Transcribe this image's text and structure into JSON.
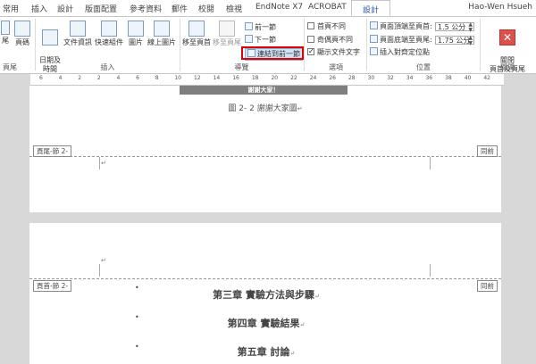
{
  "tabs": [
    {
      "label": "常用"
    },
    {
      "label": "插入"
    },
    {
      "label": "設計"
    },
    {
      "label": "版面配置"
    },
    {
      "label": "參考資料"
    },
    {
      "label": "郵件"
    },
    {
      "label": "校閱"
    },
    {
      "label": "檢視"
    },
    {
      "label": "EndNote X7"
    },
    {
      "label": "ACROBAT"
    },
    {
      "label": "設計"
    }
  ],
  "user_name": "Hao-Wen Hsueh",
  "ribbon": {
    "btn_partial1": "尾",
    "btn_page": "頁碼",
    "group_partial": "頁尾",
    "btn_datetime": "日期及\n時間",
    "btn_docinfo": "文件資訊",
    "btn_quickparts": "快速組件",
    "btn_picture": "圖片",
    "btn_online_picture": "線上圖片",
    "group_insert": "插入",
    "btn_goto_header": "移至頁首",
    "btn_goto_footer": "移至頁尾",
    "btn_previous": "前一節",
    "btn_next": "下一節",
    "btn_link_previous": "連結到前一節",
    "group_nav": "導覽",
    "opt_diff_first": "首頁不同",
    "opt_diff_oddeven": "奇偶頁不同",
    "opt_show_text": "顯示文件文字",
    "group_options": "選項",
    "pos_header_top": "頁面頂端至頁首:",
    "pos_footer_bottom": "頁面底端至頁尾:",
    "pos_header_value": "1.5 公分",
    "pos_footer_value": "1.75 公分",
    "btn_insert_align_tab": "插入對齊定位點",
    "group_position": "位置",
    "btn_close": "關閉\n頁首及頁尾",
    "group_close": "關閉"
  },
  "ruler_numbers": [
    "6",
    "4",
    "2",
    "2",
    "4",
    "6",
    "8",
    "10",
    "12",
    "14",
    "16",
    "18",
    "20",
    "22",
    "24",
    "26",
    "28",
    "30",
    "32",
    "34",
    "36",
    "38",
    "40",
    "42"
  ],
  "page1": {
    "banner": "謝謝大家！",
    "caption": "圖 2- 2 謝謝大家圖",
    "footer_tag": "頁尾-節 2-",
    "same_as_previous": "同前"
  },
  "page2": {
    "header_tag": "頁首-節 2-",
    "same_as_previous": "同前",
    "chapters": [
      "第三章 實驗方法與步驟",
      "第四章 實驗結果",
      "第五章 討論"
    ],
    "bullet": "•",
    "para_mark": "↵"
  }
}
